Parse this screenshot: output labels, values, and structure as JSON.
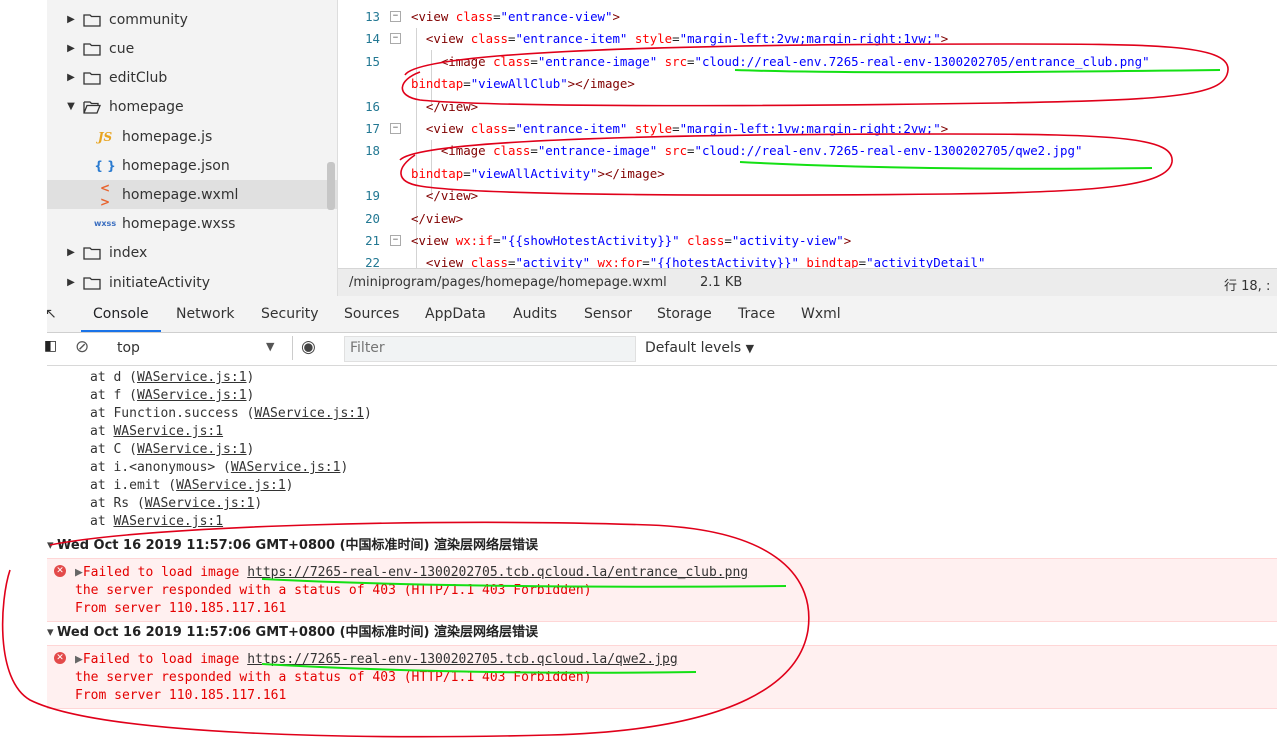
{
  "file_tree": {
    "items": [
      {
        "type": "folder",
        "state": "collapsed",
        "label": "community"
      },
      {
        "type": "folder",
        "state": "collapsed",
        "label": "cue"
      },
      {
        "type": "folder",
        "state": "collapsed",
        "label": "editClub"
      },
      {
        "type": "folder",
        "state": "expanded",
        "label": "homepage"
      },
      {
        "type": "file",
        "icon": "JS",
        "label": "homepage.js"
      },
      {
        "type": "file",
        "icon": "{ }",
        "label": "homepage.json"
      },
      {
        "type": "file",
        "icon": "< >",
        "label": "homepage.wxml",
        "selected": true
      },
      {
        "type": "file",
        "icon": "wxss",
        "label": "homepage.wxss"
      },
      {
        "type": "folder",
        "state": "collapsed",
        "label": "index"
      },
      {
        "type": "folder",
        "state": "collapsed",
        "label": "initiateActivity"
      }
    ]
  },
  "editor": {
    "lines": [
      {
        "num": "13",
        "fold": "⊟",
        "parts": [
          {
            "t": "<view ",
            "c": "tag"
          },
          {
            "t": "class",
            "c": "at"
          },
          {
            "t": "=",
            "c": ""
          },
          {
            "t": "\"entrance-view\"",
            "c": "av"
          },
          {
            "t": ">",
            "c": "tag"
          }
        ]
      },
      {
        "num": "14",
        "fold": "⊟",
        "parts": [
          {
            "t": "  <view ",
            "c": "tag"
          },
          {
            "t": "class",
            "c": "at"
          },
          {
            "t": "=",
            "c": ""
          },
          {
            "t": "\"entrance-item\"",
            "c": "av"
          },
          {
            "t": " style",
            "c": "at"
          },
          {
            "t": "=",
            "c": ""
          },
          {
            "t": "\"margin-left:2vw;margin-right:1vw;\"",
            "c": "av"
          },
          {
            "t": ">",
            "c": "tag"
          }
        ]
      },
      {
        "num": "15",
        "fold": "",
        "parts": [
          {
            "t": "    <image ",
            "c": "tag"
          },
          {
            "t": "class",
            "c": "at"
          },
          {
            "t": "=",
            "c": ""
          },
          {
            "t": "\"entrance-image\"",
            "c": "av"
          },
          {
            "t": " src",
            "c": "at"
          },
          {
            "t": "=",
            "c": ""
          },
          {
            "t": "\"cloud://real-env.7265-real-env-1300202705/entrance_club.png\"",
            "c": "av"
          }
        ]
      },
      {
        "num": "",
        "fold": "",
        "parts": [
          {
            "t": "bindtap",
            "c": "at"
          },
          {
            "t": "=",
            "c": ""
          },
          {
            "t": "\"viewAllClub\"",
            "c": "av"
          },
          {
            "t": "></image>",
            "c": "tag"
          }
        ]
      },
      {
        "num": "16",
        "fold": "",
        "parts": [
          {
            "t": "  </view>",
            "c": "tag"
          }
        ]
      },
      {
        "num": "17",
        "fold": "⊟",
        "parts": [
          {
            "t": "  <view ",
            "c": "tag"
          },
          {
            "t": "class",
            "c": "at"
          },
          {
            "t": "=",
            "c": ""
          },
          {
            "t": "\"entrance-item\"",
            "c": "av"
          },
          {
            "t": " style",
            "c": "at"
          },
          {
            "t": "=",
            "c": ""
          },
          {
            "t": "\"margin-left:1vw;margin-right:2vw;\"",
            "c": "av"
          },
          {
            "t": ">",
            "c": "tag"
          }
        ]
      },
      {
        "num": "18",
        "fold": "",
        "parts": [
          {
            "t": "    <image ",
            "c": "tag"
          },
          {
            "t": "class",
            "c": "at"
          },
          {
            "t": "=",
            "c": ""
          },
          {
            "t": "\"entrance-image\"",
            "c": "av"
          },
          {
            "t": " src",
            "c": "at"
          },
          {
            "t": "=",
            "c": ""
          },
          {
            "t": "\"cloud://real-env.7265-real-env-1300202705/qwe2.jpg\"",
            "c": "av"
          }
        ]
      },
      {
        "num": "",
        "fold": "",
        "parts": [
          {
            "t": "bindtap",
            "c": "at"
          },
          {
            "t": "=",
            "c": ""
          },
          {
            "t": "\"viewAllActivity\"",
            "c": "av"
          },
          {
            "t": "></image>",
            "c": "tag"
          }
        ]
      },
      {
        "num": "19",
        "fold": "",
        "parts": [
          {
            "t": "  </view>",
            "c": "tag"
          }
        ]
      },
      {
        "num": "20",
        "fold": "",
        "parts": [
          {
            "t": "</view>",
            "c": "tag"
          }
        ]
      },
      {
        "num": "21",
        "fold": "⊟",
        "parts": [
          {
            "t": "<view ",
            "c": "tag"
          },
          {
            "t": "wx:if",
            "c": "at"
          },
          {
            "t": "=",
            "c": ""
          },
          {
            "t": "\"{{showHotestActivity}}\"",
            "c": "av"
          },
          {
            "t": " class",
            "c": "at"
          },
          {
            "t": "=",
            "c": ""
          },
          {
            "t": "\"activity-view\"",
            "c": "av"
          },
          {
            "t": ">",
            "c": "tag"
          }
        ]
      },
      {
        "num": "22",
        "fold": "",
        "parts": [
          {
            "t": "  <view ",
            "c": "tag"
          },
          {
            "t": "class",
            "c": "at"
          },
          {
            "t": "=",
            "c": ""
          },
          {
            "t": "\"activity\"",
            "c": "av"
          },
          {
            "t": " wx:for",
            "c": "at"
          },
          {
            "t": "=",
            "c": ""
          },
          {
            "t": "\"{{hotestActivity}}\"",
            "c": "av"
          },
          {
            "t": " bindtap",
            "c": "at"
          },
          {
            "t": "=",
            "c": ""
          },
          {
            "t": "\"activityDetail\"",
            "c": "av"
          }
        ]
      }
    ]
  },
  "status_bar": {
    "path": "/miniprogram/pages/homepage/homepage.wxml",
    "size": "2.1 KB",
    "position": "行 18, :"
  },
  "devtools": {
    "tabs": [
      "Console",
      "Network",
      "Security",
      "Sources",
      "AppData",
      "Audits",
      "Sensor",
      "Storage",
      "Trace",
      "Wxml"
    ],
    "active_tab": "Console"
  },
  "console_toolbar": {
    "context": "top",
    "filter_placeholder": "Filter",
    "levels": "Default levels"
  },
  "console": {
    "stack": [
      {
        "pre": "at d (",
        "link": "WAService.js:1",
        "post": ")"
      },
      {
        "pre": "at f (",
        "link": "WAService.js:1",
        "post": ")"
      },
      {
        "pre": "at Function.success (",
        "link": "WAService.js:1",
        "post": ")"
      },
      {
        "pre": "at ",
        "link": "WAService.js:1",
        "post": ""
      },
      {
        "pre": "at C (",
        "link": "WAService.js:1",
        "post": ")"
      },
      {
        "pre": "at i.<anonymous> (",
        "link": "WAService.js:1",
        "post": ")"
      },
      {
        "pre": "at i.emit (",
        "link": "WAService.js:1",
        "post": ")"
      },
      {
        "pre": "at Rs (",
        "link": "WAService.js:1",
        "post": ")"
      },
      {
        "pre": "at ",
        "link": "WAService.js:1",
        "post": ""
      }
    ],
    "groups": [
      {
        "header": "Wed Oct 16 2019 11:57:06 GMT+0800 (中国标准时间) 渲染层网络层错误",
        "msg_prefix": "Failed to load image ",
        "url": "https://7265-real-env-1300202705.tcb.qcloud.la/entrance_club.png",
        "line2": "the server responded with a status of 403 (HTTP/1.1 403 Forbidden)",
        "line3": "From server 110.185.117.161"
      },
      {
        "header": "Wed Oct 16 2019 11:57:06 GMT+0800 (中国标准时间) 渲染层网络层错误",
        "msg_prefix": "Failed to load image ",
        "url": "https://7265-real-env-1300202705.tcb.qcloud.la/qwe2.jpg",
        "line2": "the server responded with a status of 403 (HTTP/1.1 403 Forbidden)",
        "line3": "From server 110.185.117.161"
      }
    ]
  },
  "annotation_colors": {
    "circle": "#e0001a",
    "underline": "#14e014"
  }
}
